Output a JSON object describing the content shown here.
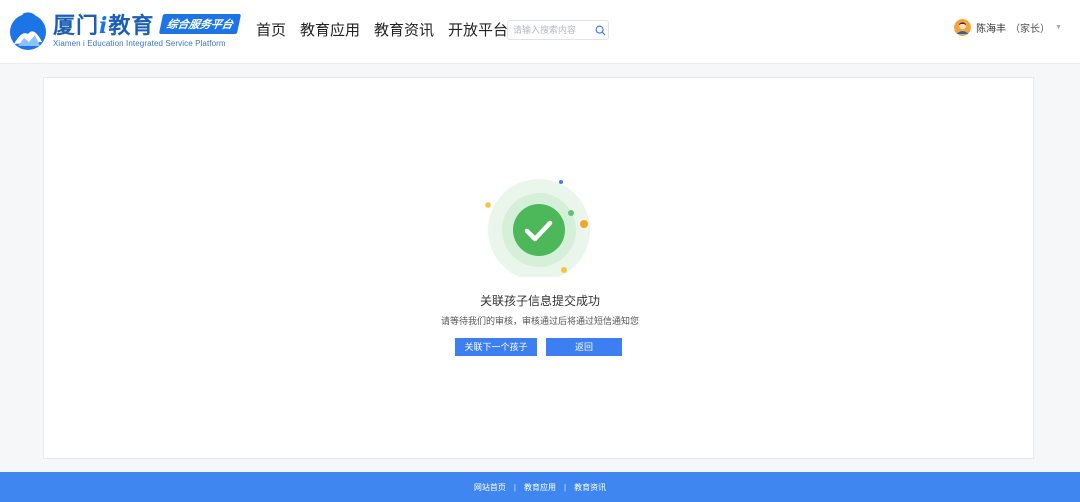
{
  "header": {
    "logo": {
      "title_prefix": "厦门",
      "title_i": "i",
      "title_suffix": "教育",
      "badge": "综合服务平台",
      "subtitle": "Xiamen i Education Integrated Service Platform"
    },
    "nav": [
      {
        "label": "首页"
      },
      {
        "label": "教育应用"
      },
      {
        "label": "教育资讯"
      },
      {
        "label": "开放平台"
      }
    ],
    "search": {
      "placeholder": "请输入搜索内容",
      "value": "",
      "icon": "search-icon"
    },
    "user": {
      "name": "陈海丰",
      "role": "（家长）",
      "icon": "chevron-down-icon"
    }
  },
  "result": {
    "title": "关联孩子信息提交成功",
    "description": "请等待我们的审核，审核通过后将通过短信通知您",
    "buttons": {
      "next_child": "关联下一个孩子",
      "back": "返回"
    },
    "icon": "check-circle-icon"
  },
  "footer": {
    "links": [
      "网站首页",
      "教育应用",
      "教育资讯"
    ],
    "separator": "|"
  },
  "colors": {
    "primary": "#3d7ff2",
    "success": "#4cb85a",
    "footer_bg": "#3f86f0",
    "logo_blue": "#1c5fb8"
  }
}
